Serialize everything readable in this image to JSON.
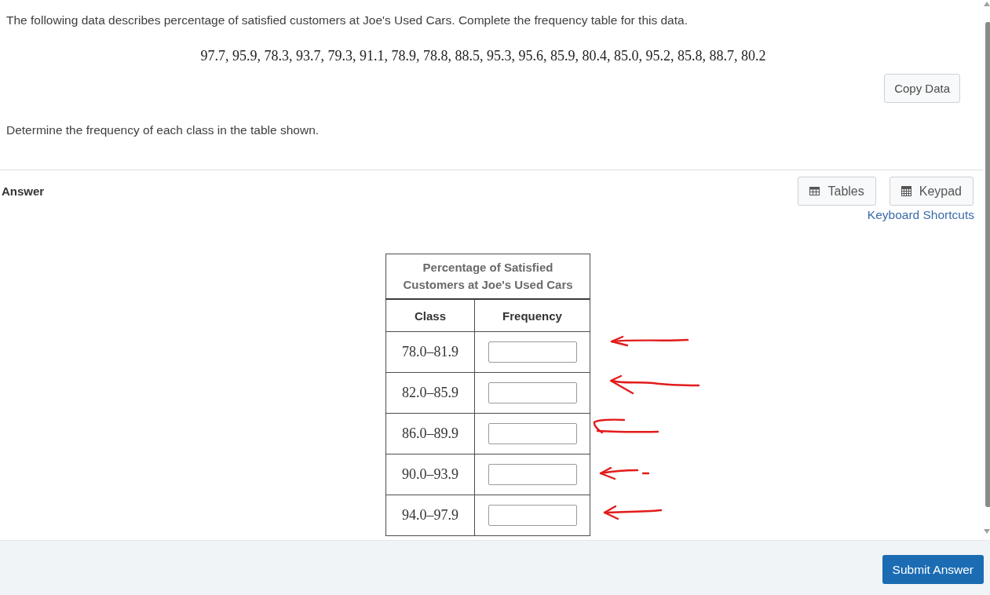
{
  "question": {
    "prompt": "The following data describes percentage of satisfied customers at Joe's Used Cars. Complete the frequency table for this data.",
    "data_values": "97.7, 95.9, 78.3, 93.7, 79.3, 91.1, 78.9, 78.8, 88.5, 95.3, 95.6, 85.9, 80.4, 85.0, 95.2, 85.8, 88.7, 80.2",
    "copy_button": "Copy Data",
    "instruction": "Determine the frequency of each class in the table shown."
  },
  "answer": {
    "label": "Answer",
    "tools": [
      {
        "kind": "tables",
        "label": "Tables"
      },
      {
        "kind": "keypad",
        "label": "Keypad"
      }
    ],
    "shortcuts_link": "Keyboard Shortcuts"
  },
  "table": {
    "title": "Percentage of Satisfied Customers at Joe's Used Cars",
    "columns": [
      "Class",
      "Frequency"
    ],
    "rows": [
      {
        "class": "78.0–81.9",
        "hand_drawn_arrow": true
      },
      {
        "class": "82.0–85.9",
        "hand_drawn_arrow": true
      },
      {
        "class": "86.0–89.9",
        "hand_drawn_arrow": true
      },
      {
        "class": "90.0–93.9",
        "hand_drawn_arrow": true
      },
      {
        "class": "94.0–97.9",
        "hand_drawn_arrow": true
      }
    ]
  },
  "footer": {
    "submit_button": "Submit Answer"
  }
}
